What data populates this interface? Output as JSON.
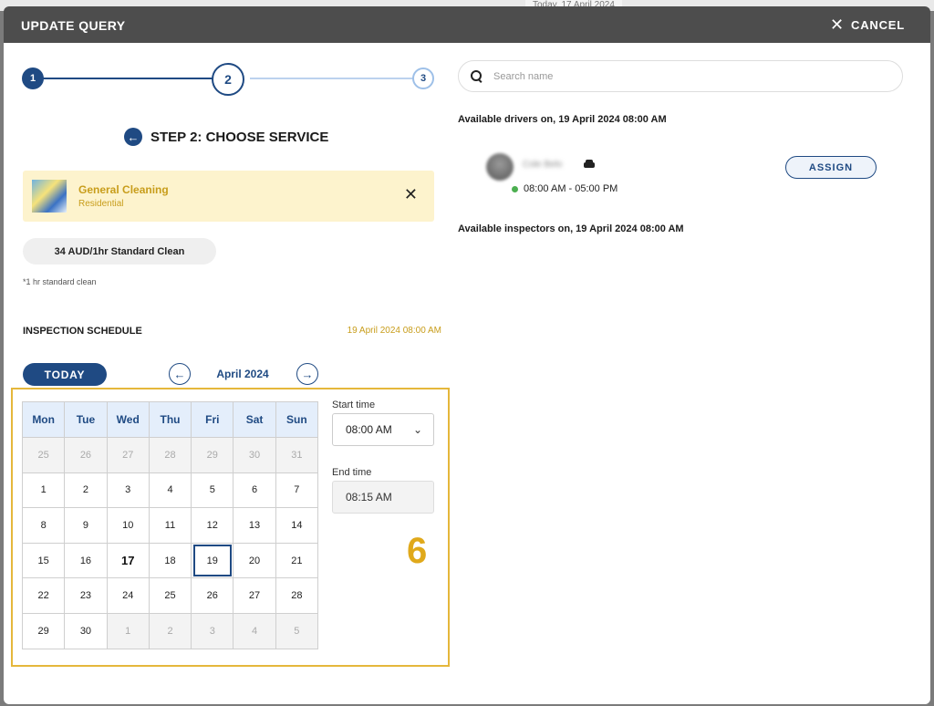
{
  "background": {
    "date_text": "Today, 17 April 2024"
  },
  "modal": {
    "title": "UPDATE QUERY",
    "cancel_label": "CANCEL"
  },
  "stepper": {
    "steps": [
      "1",
      "2",
      "3"
    ],
    "current": 2
  },
  "step_title": "STEP 2: CHOOSE SERVICE",
  "service": {
    "name": "General Cleaning",
    "category": "Residential"
  },
  "price": {
    "pill": "34 AUD/1hr Standard Clean",
    "note": "*1 hr standard clean"
  },
  "inspection": {
    "label": "INSPECTION SCHEDULE",
    "date": "19 April 2024 08:00 AM"
  },
  "calendar": {
    "today_label": "TODAY",
    "month": "April 2024",
    "weekdays": [
      "Mon",
      "Tue",
      "Wed",
      "Thu",
      "Fri",
      "Sat",
      "Sun"
    ],
    "weeks": [
      [
        {
          "d": "25",
          "out": true
        },
        {
          "d": "26",
          "out": true
        },
        {
          "d": "27",
          "out": true
        },
        {
          "d": "28",
          "out": true
        },
        {
          "d": "29",
          "out": true
        },
        {
          "d": "30",
          "out": true
        },
        {
          "d": "31",
          "out": true
        }
      ],
      [
        {
          "d": "1"
        },
        {
          "d": "2"
        },
        {
          "d": "3"
        },
        {
          "d": "4"
        },
        {
          "d": "5"
        },
        {
          "d": "6"
        },
        {
          "d": "7"
        }
      ],
      [
        {
          "d": "8"
        },
        {
          "d": "9"
        },
        {
          "d": "10"
        },
        {
          "d": "11"
        },
        {
          "d": "12"
        },
        {
          "d": "13"
        },
        {
          "d": "14"
        }
      ],
      [
        {
          "d": "15"
        },
        {
          "d": "16"
        },
        {
          "d": "17",
          "today": true
        },
        {
          "d": "18"
        },
        {
          "d": "19",
          "selected": true
        },
        {
          "d": "20"
        },
        {
          "d": "21"
        }
      ],
      [
        {
          "d": "22"
        },
        {
          "d": "23"
        },
        {
          "d": "24"
        },
        {
          "d": "25"
        },
        {
          "d": "26"
        },
        {
          "d": "27"
        },
        {
          "d": "28"
        }
      ],
      [
        {
          "d": "29"
        },
        {
          "d": "30"
        },
        {
          "d": "1",
          "out": true
        },
        {
          "d": "2",
          "out": true
        },
        {
          "d": "3",
          "out": true
        },
        {
          "d": "4",
          "out": true
        },
        {
          "d": "5",
          "out": true
        }
      ]
    ]
  },
  "time": {
    "start_label": "Start time",
    "start_value": "08:00 AM",
    "end_label": "End time",
    "end_value": "08:15 AM"
  },
  "annotation": "6",
  "search": {
    "placeholder": "Search name"
  },
  "drivers": {
    "heading": "Available drivers on, 19 April 2024 08:00 AM",
    "items": [
      {
        "name": "Cole Belo",
        "hours": "08:00 AM - 05:00 PM",
        "assign_label": "ASSIGN"
      }
    ]
  },
  "inspectors": {
    "heading": "Available inspectors on, 19 April 2024 08:00 AM"
  },
  "colors": {
    "primary": "#1f4a83",
    "accent_gold": "#c89d1b",
    "highlight": "#e5b73b",
    "status_green": "#4caf50"
  }
}
